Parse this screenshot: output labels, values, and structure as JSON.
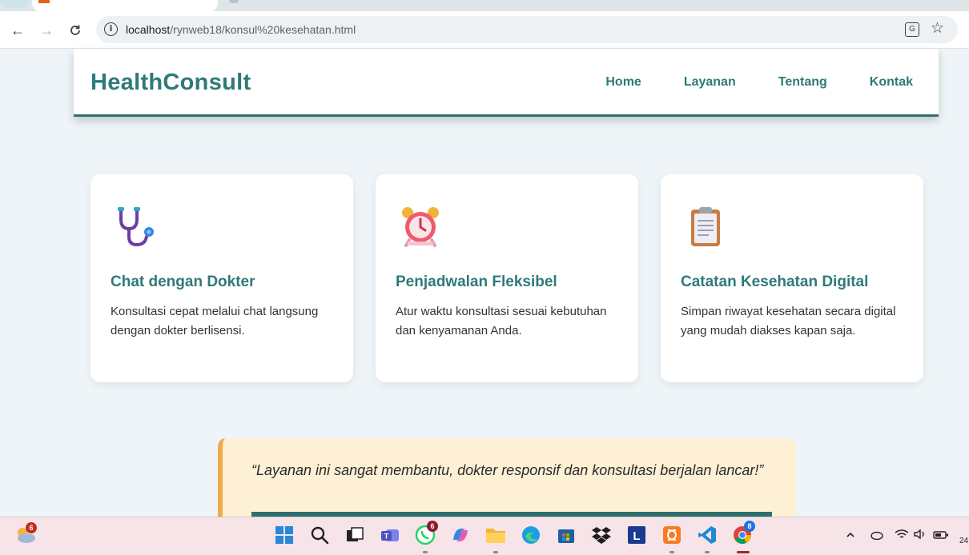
{
  "browser": {
    "url_host": "localhost",
    "url_path": "/rynweb18/konsul%20kesehatan.html"
  },
  "header": {
    "logo": "HealthConsult",
    "nav": [
      "Home",
      "Layanan",
      "Tentang",
      "Kontak"
    ]
  },
  "features": [
    {
      "icon": "stethoscope-icon",
      "title": "Chat dengan Dokter",
      "desc": "Konsultasi cepat melalui chat langsung dengan dokter berlisensi."
    },
    {
      "icon": "alarm-clock-icon",
      "title": "Penjadwalan Fleksibel",
      "desc": "Atur waktu konsultasi sesuai kebutuhan dan kenyamanan Anda."
    },
    {
      "icon": "clipboard-icon",
      "title": "Catatan Kesehatan Digital",
      "desc": "Simpan riwayat kesehatan secara digital yang mudah diakses kapan saja."
    }
  ],
  "testimonial": {
    "quote": "“Layanan ini sangat membantu, dokter responsif dan konsultasi berjalan lancar!”"
  },
  "taskbar": {
    "weather_badge": "6",
    "whatsapp_badge": "6",
    "chrome_badge": "8",
    "clock_partial": "24"
  },
  "colors": {
    "brand": "#2e7a78",
    "page_bg": "#eef4f7",
    "testimonial_bg": "#fdf0d4",
    "testimonial_accent": "#f0a94b"
  }
}
